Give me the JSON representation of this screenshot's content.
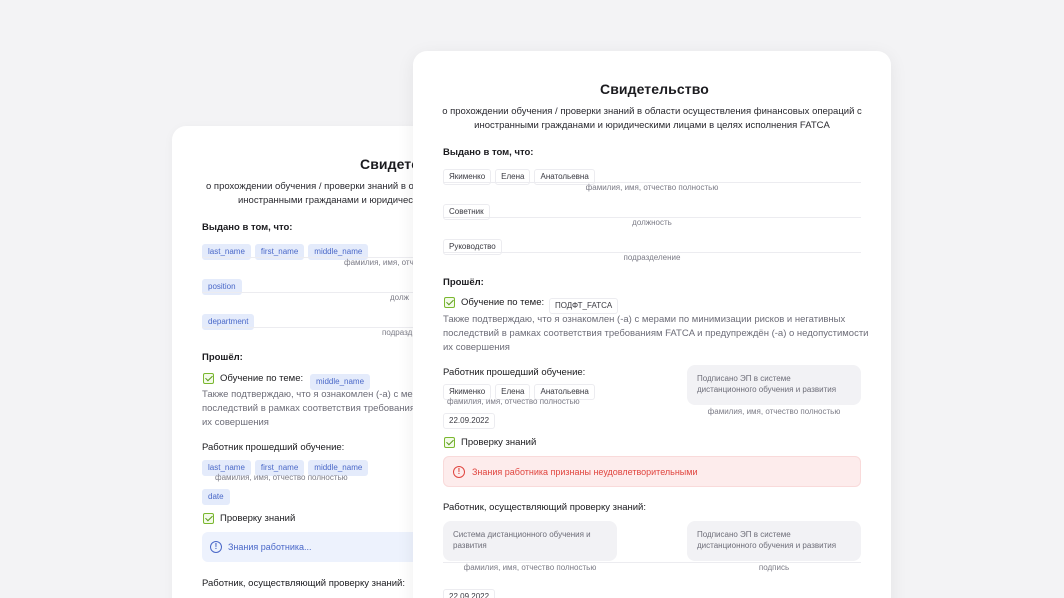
{
  "back_card": {
    "title": "Свидетельство",
    "subtitle_line1": "о прохождении обучения / проверки знаний в о",
    "subtitle_line2": "иностранными гражданами и юридичес",
    "issued_label": "Выдано в том, что:",
    "name_chips": [
      "last_name",
      "first_name",
      "middle_name"
    ],
    "name_caption": "фамилия, имя, отчес",
    "position_chip": "position",
    "position_caption": "долж",
    "department_chip": "department",
    "department_caption": "подразд",
    "passed_label": "Прошёл:",
    "training_label": "Обучение по теме:",
    "training_chip": "middle_name",
    "para_line1": "Также подтверждаю, что я ознакомлен (-а) с мер",
    "para_line2": "последствий в рамках соответствия требования",
    "para_line3": "их совершения",
    "worker_label": "Работник прошедший обучение:",
    "worker_chips": [
      "last_name",
      "first_name",
      "middle_name"
    ],
    "worker_caption": "фамилия, имя, отчество полностью",
    "date_chip": "date",
    "knowledge_label": "Проверку знаний",
    "alert_text": "Знания работника...",
    "checker_label": "Работник, осуществляющий проверку знаний:"
  },
  "front_card": {
    "title": "Свидетельство",
    "subtitle_line1": "о прохождении обучения / проверки знаний в области осуществления финансовых операций с",
    "subtitle_line2": "иностранными гражданами и юридическими лицами в целях исполнения FATCA",
    "issued_label": "Выдано в том, что:",
    "name_chips": [
      "Якименко",
      "Елена",
      "Анатольевна"
    ],
    "name_caption": "фамилия, имя, отчество полностью",
    "position_chip": "Советник",
    "position_caption": "должность",
    "department_chip": "Руководство",
    "department_caption": "подразделение",
    "passed_label": "Прошёл:",
    "training_label": "Обучение по теме:",
    "training_chip": "ПОДФТ_FATCA",
    "para_line1": "Также подтверждаю, что я ознакомлен (-а) с мерами по минимизации рисков и негативных",
    "para_line2": "последствий в рамках соответствия требованиям FATCA и предупреждён (-а) о недопустимости",
    "para_line3": "их совершения",
    "worker_label": "Работник прошедший обучение:",
    "worker_chips": [
      "Якименко",
      "Елена",
      "Анатольевна"
    ],
    "worker_caption": "фамилия, имя, отчество полностью",
    "worker_date": "22.09.2022",
    "signature_box": "Подписано ЭП в системе дистанционного обучения и развития",
    "signature_caption": "фамилия, имя, отчество полностью",
    "knowledge_label": "Проверку знаний",
    "alert_text": "Знания работника признаны неудовлетворительными",
    "checker_label": "Работник, осуществляющий проверку знаний:",
    "checker_box": "Система дистанционного обучения и развития",
    "checker_caption": "фамилия, имя, отчество полностью",
    "checker_sign_box": "Подписано ЭП в системе дистанционного обучения и развития",
    "checker_sign_caption": "подпись",
    "checker_date": "22.09.2022"
  },
  "colors": {
    "background": "#f3f3f5",
    "card": "#ffffff",
    "chip_blue_bg": "#e4ebfb",
    "chip_blue_text": "#4a68c8",
    "check_green": "#7ab82f",
    "alert_red": "#e0453f",
    "alert_red_bg": "#fdecec"
  }
}
